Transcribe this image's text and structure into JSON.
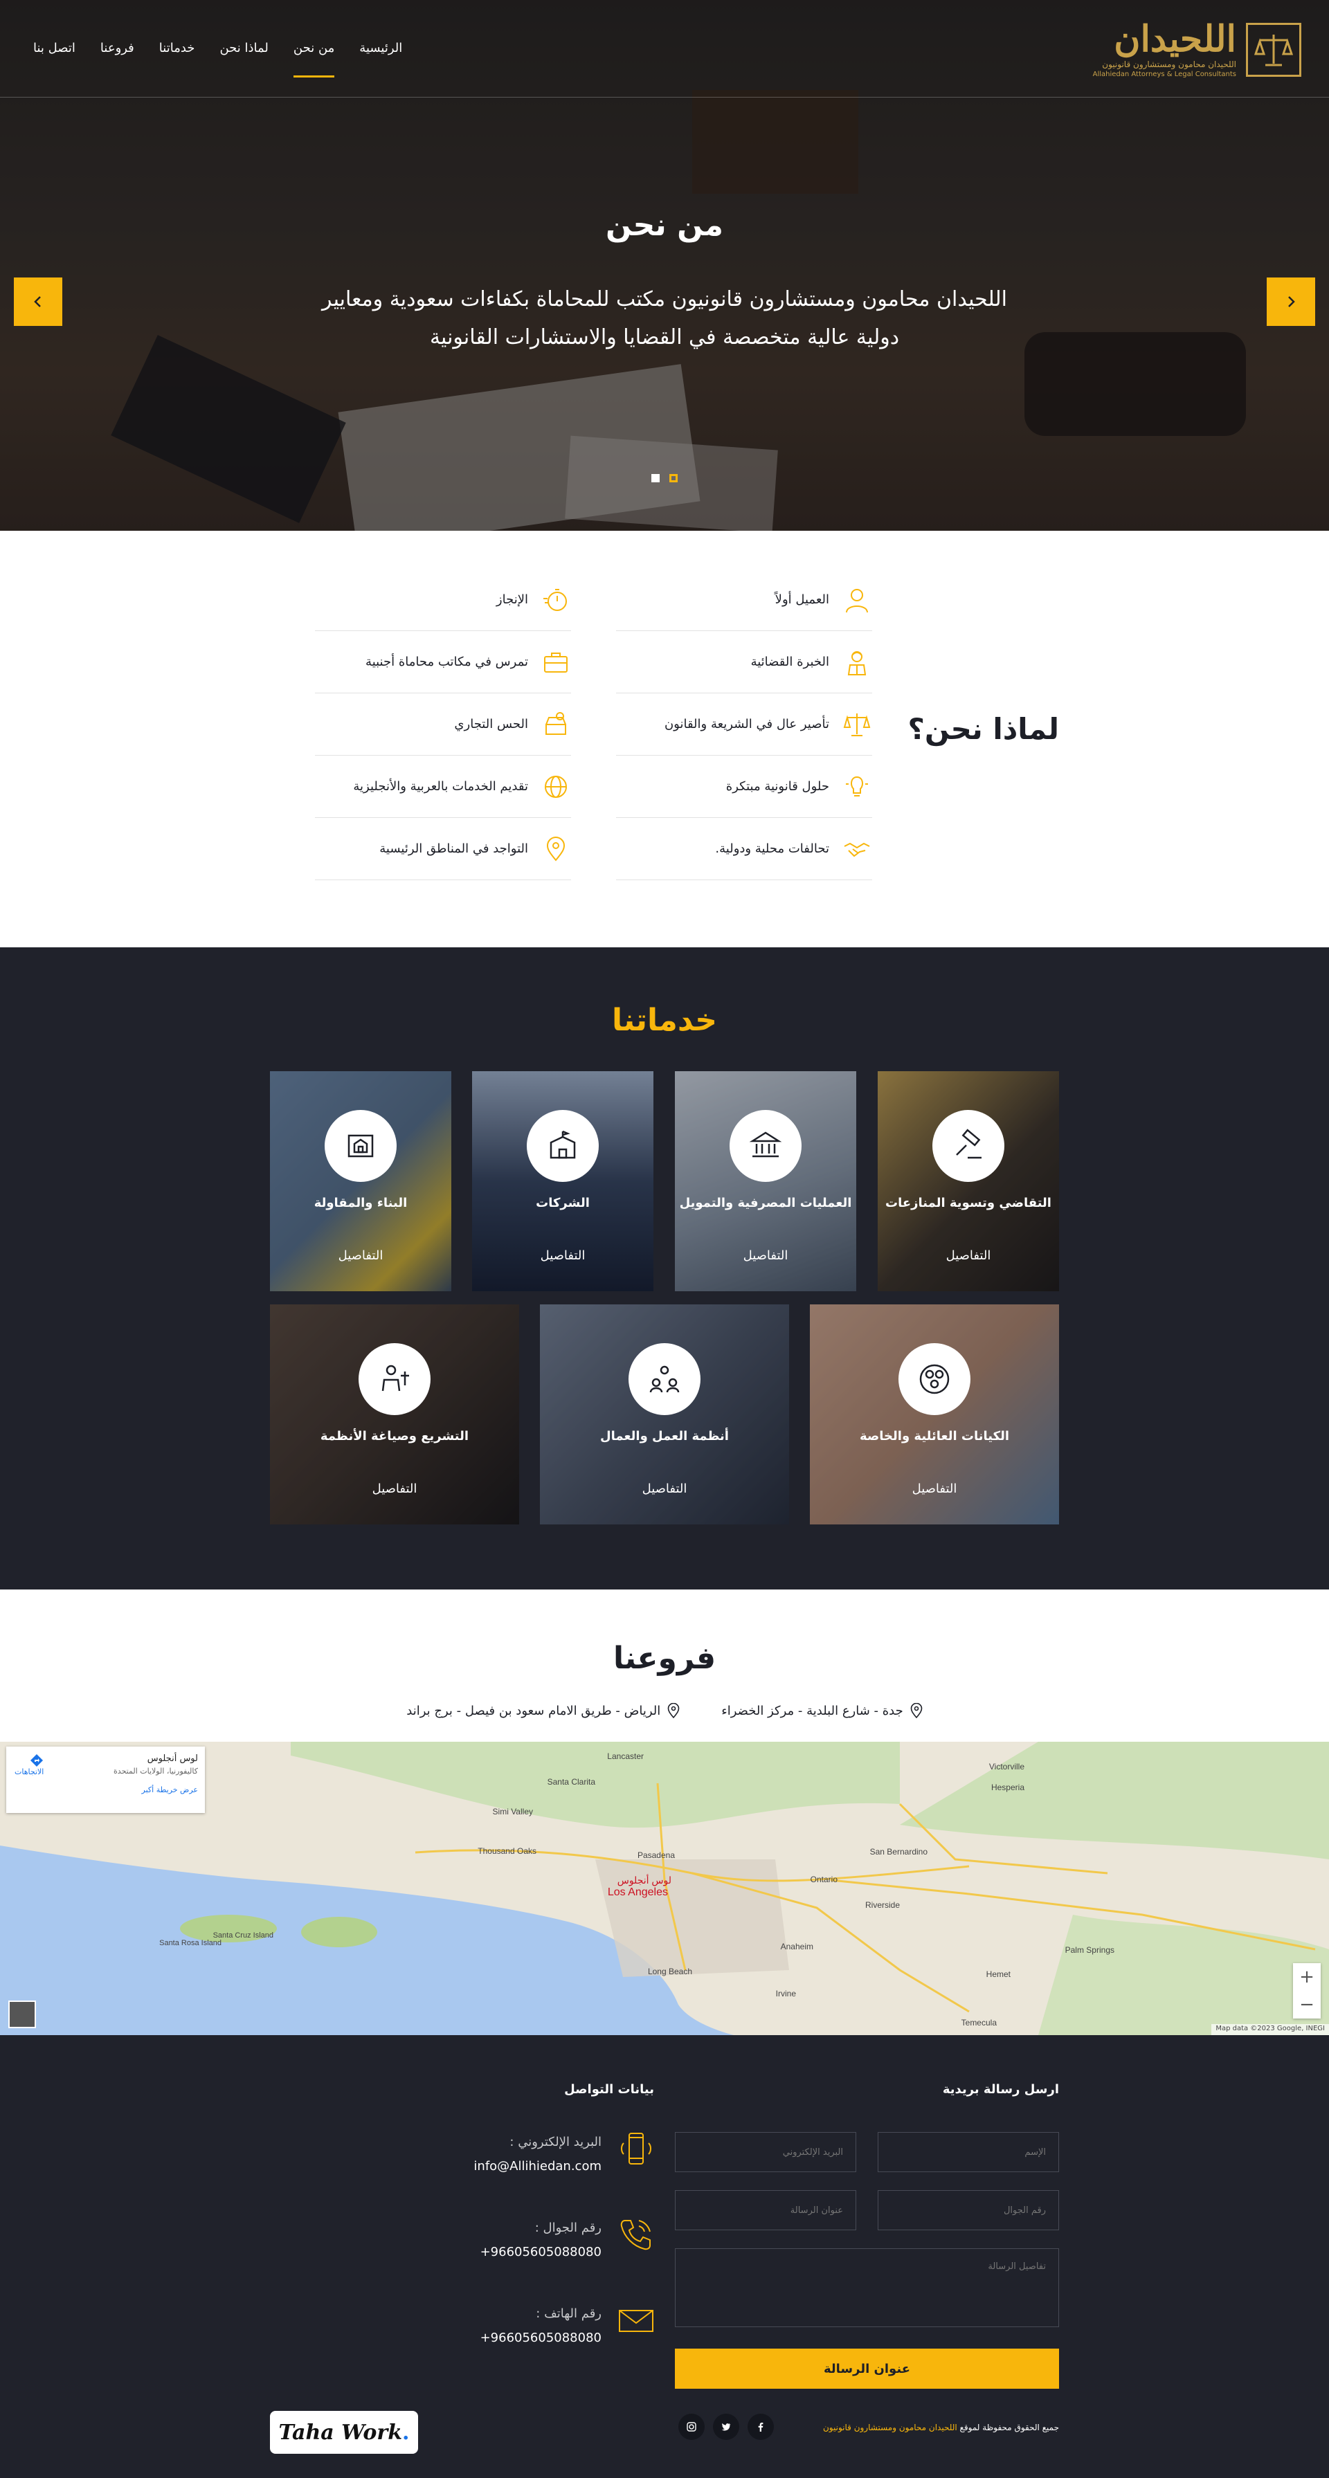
{
  "logo": {
    "brand": "اللحيدان",
    "line1": "اللحيدان محامون ومستشارون قانونيون",
    "line2": "Allahiedan Attorneys & Legal Consultants"
  },
  "nav": [
    {
      "label": "اتصل بنا",
      "name": "nav-contact"
    },
    {
      "label": "فروعنا",
      "name": "nav-branches"
    },
    {
      "label": "خدماتنا",
      "name": "nav-services"
    },
    {
      "label": "لماذا نحن",
      "name": "nav-why-us"
    },
    {
      "label": "من نحن",
      "name": "nav-about",
      "active": true
    },
    {
      "label": "الرئيسية",
      "name": "nav-home"
    }
  ],
  "hero": {
    "title": "من نحن",
    "text": "اللحيدان محامون ومستشارون قانونيون مكتب للمحاماة بكفاءات سعودية ومعايير دولية عالية متخصصة في القضايا والاستشارات القانونية"
  },
  "why": {
    "title": "لماذا نحن؟",
    "right": [
      {
        "label": "العميل أولاً",
        "icon": "user-icon"
      },
      {
        "label": "الخبرة القضائية",
        "icon": "judge-icon"
      },
      {
        "label": "تأصير عال في الشريعة والقانون",
        "icon": "scales-icon"
      },
      {
        "label": "حلول قانونية مبتكرة",
        "icon": "lightbulb-icon"
      },
      {
        "label": "تحالفات محلية ودولية.",
        "icon": "handshake-icon"
      }
    ],
    "left": [
      {
        "label": "الإنجاز",
        "icon": "stopwatch-icon"
      },
      {
        "label": "تمرس في مكاتب محاماة أجنبية",
        "icon": "briefcase-icon"
      },
      {
        "label": "الحس التجاري",
        "icon": "commerce-icon"
      },
      {
        "label": "تقديم الخدمات بالعربية والأنجليزية",
        "icon": "globe-icon"
      },
      {
        "label": "التواجد في المناطق الرئيسية",
        "icon": "map-pin-icon"
      }
    ]
  },
  "services": {
    "title": "خدماتنا",
    "details_label": "التفاصيل",
    "items": [
      {
        "title": "التقاضي وتسوية المنازعات",
        "icon": "gavel-icon",
        "bg": "#3b2f20"
      },
      {
        "title": "العمليات المصرفية والتمويل",
        "icon": "bank-icon",
        "bg": "#7d8894"
      },
      {
        "title": "الشركات",
        "icon": "building-icon",
        "bg": "#34425b"
      },
      {
        "title": "البناء والمقاولة",
        "icon": "blueprint-icon",
        "bg": "#57708a"
      },
      {
        "title": "الكيانات العائلية والخاصة",
        "icon": "family-icon",
        "bg": "#b4876a"
      },
      {
        "title": "أنظمة العمل والعمال",
        "icon": "team-icon",
        "bg": "#4b5362"
      },
      {
        "title": "التشريع وصياغة الأنظمة",
        "icon": "lawmaker-icon",
        "bg": "#3c2e22"
      }
    ]
  },
  "branches": {
    "title": "فروعنا",
    "items": [
      "جدة - شارع البلدية - مركز الخضراء",
      "الرياض - طريق الامام سعود بن فيصل - برج براند"
    ]
  },
  "map": {
    "card_title": "لوس أنجلوس",
    "card_sub": "كاليفورنيا، الولايات المتحدة",
    "card_link": "عرض خريطة أكبر",
    "directions": "الاتجاهات",
    "footer": "Map data ©2023 Google, INEGI",
    "labels": [
      "Santa Clarita",
      "Thousand Oaks",
      "Pasadena",
      "Los Angeles",
      "لوس أنجلوس",
      "San Bernardino",
      "Anaheim",
      "Riverside",
      "Long Beach",
      "Irvine",
      "Palm Springs",
      "Hemet",
      "Temecula",
      "Ontario",
      "Santa Cruz Island",
      "Santa Rosa Island",
      "Simi Valley",
      "Victorville",
      "Hesperia",
      "Lancaster"
    ]
  },
  "footer": {
    "form_title": "ارسل رسالة بريدية",
    "fields": {
      "name": "الإسم",
      "email": "البريد الإلكتروني",
      "phone": "رقم الجوال",
      "subject": "عنوان الرسالة",
      "message": "تفاصيل الرسالة"
    },
    "submit": "عنوان الرسالة",
    "contact_title": "بيانات التواصل",
    "contacts": [
      {
        "label": "البريد الإلكتروني :",
        "value": "info@Allihiedan.com",
        "icon": "mobile-icon"
      },
      {
        "label": "رقم الجوال :",
        "value": "+96605605088080",
        "icon": "phone-icon"
      },
      {
        "label": "رقم الهاتف :",
        "value": "+96605605088080",
        "icon": "envelope-icon"
      }
    ],
    "copyright_prefix": "جميع الحقوق محفوظة لموقع",
    "copyright_brand": "اللحيدان محامون ومستشارون قانونيون",
    "badge": "Taha Work",
    "social": [
      "facebook-icon",
      "twitter-icon",
      "instagram-icon"
    ]
  },
  "colors": {
    "accent": "#f8b60c",
    "dark": "#20222b",
    "gold": "#c9a24a"
  }
}
